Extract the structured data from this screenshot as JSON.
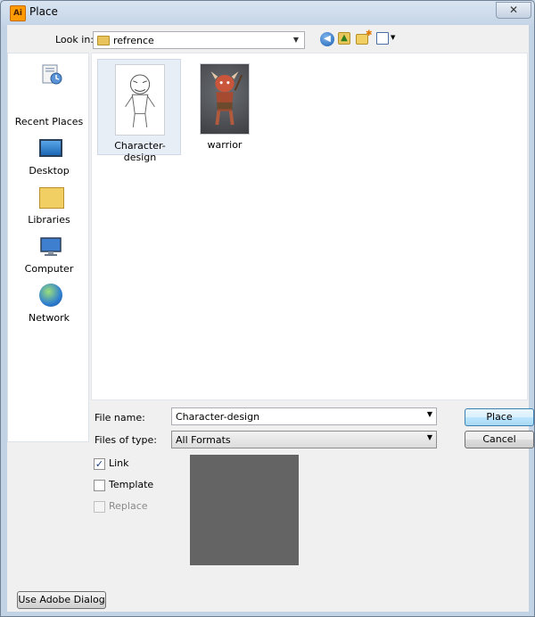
{
  "window": {
    "title": "Place",
    "app_icon_text": "Ai",
    "close_glyph": "✕"
  },
  "toolbar": {
    "look_in_label": "Look in:",
    "look_in_value": "refrence",
    "icons": [
      "back-icon",
      "up-folder-icon",
      "new-folder-icon",
      "views-menu-icon"
    ]
  },
  "places": [
    {
      "label": "Recent Places",
      "icon": "recent-places-icon"
    },
    {
      "label": "Desktop",
      "icon": "desktop-icon"
    },
    {
      "label": "Libraries",
      "icon": "libraries-icon"
    },
    {
      "label": "Computer",
      "icon": "computer-icon"
    },
    {
      "label": "Network",
      "icon": "network-icon"
    }
  ],
  "files": [
    {
      "name": "Character-design",
      "selected": true
    },
    {
      "name": "warrior",
      "selected": false
    }
  ],
  "form": {
    "file_name_label": "File name:",
    "file_name_value": "Character-design",
    "files_of_type_label": "Files of type:",
    "files_of_type_value": "All Formats",
    "place_button": "Place",
    "cancel_button": "Cancel"
  },
  "options": {
    "link": {
      "label": "Link",
      "checked": true
    },
    "template": {
      "label": "Template",
      "checked": false
    },
    "replace": {
      "label": "Replace",
      "checked": false,
      "disabled": true
    }
  },
  "footer": {
    "use_adobe_dialog": "Use Adobe Dialog"
  },
  "colors": {
    "accent": "#3c7fb1",
    "preview_bg": "#646464"
  }
}
